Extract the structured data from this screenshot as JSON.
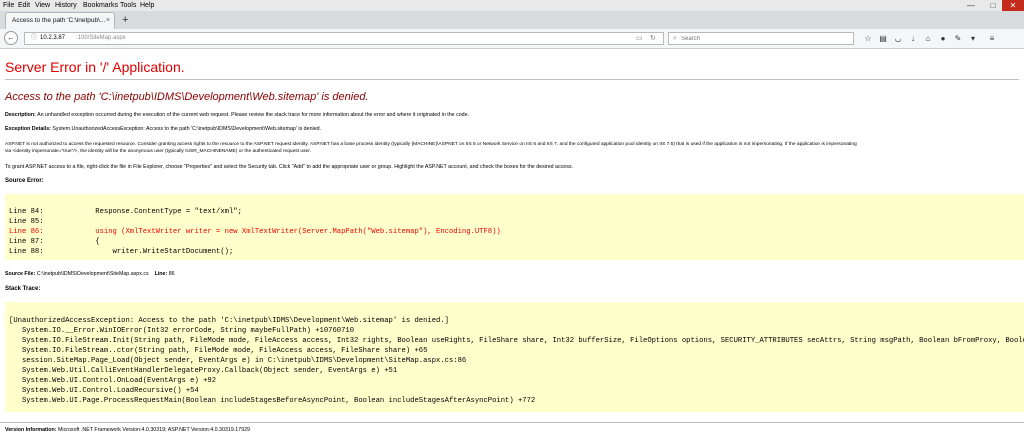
{
  "menu": {
    "items": [
      "File",
      "Edit",
      "View",
      "History",
      "Bookmarks",
      "Tools",
      "Help"
    ]
  },
  "window_controls": {
    "minimize": "—",
    "maximize": "□",
    "close": "✕"
  },
  "tab": {
    "title": "Access to the path 'C:\\inetpub\\...",
    "close": "×"
  },
  "new_tab": "+",
  "nav": {
    "back": "←",
    "url_host": "10.2.3.87",
    "url_path": ":100/SiteMap.aspx",
    "search_placeholder": "Search"
  },
  "page": {
    "h1": "Server Error in '/' Application.",
    "h2": "Access to the path 'C:\\inetpub\\IDMS\\Development\\Web.sitemap' is denied.",
    "description_label": "Description:",
    "description_text": " An unhandled exception occurred during the execution of the current web request. Please review the stack trace for more information about the error and where it originated in the code.",
    "exception_label": "Exception Details:",
    "exception_text": " System.UnauthorizedAccessException: Access to the path 'C:\\inetpub\\IDMS\\Development\\Web.sitemap' is denied.",
    "aspnet_line1": "ASP.NET is not authorized to access the requested resource. Consider granting access rights to the resource to the ASP.NET request identity. ASP.NET has a base process identity (typically {MACHINE}\\ASPNET on IIS 5 or Network Service on IIS 6 and IIS 7, and the configured application pool identity on IIS 7.5) that is used if the application is not impersonating. If the application is impersonating",
    "aspnet_line2": "via <identity impersonate=\"true\"/>, the identity will be the anonymous user (typically IUSR_MACHINENAME) or the authenticated request user.",
    "grant_text": "To grant ASP.NET access to a file, right-click the file in File Explorer, choose \"Properties\" and select the Security tab. Click \"Add\" to add the appropriate user or group. Highlight the ASP.NET account, and check the boxes for the desired access.",
    "source_error_label": "Source Error:",
    "source_lines": [
      "Line 84:            Response.ContentType = \"text/xml\";",
      "Line 85:",
      "Line 86:            using (XmlTextWriter writer = new XmlTextWriter(Server.MapPath(\"Web.sitemap\"), Encoding.UTF8))",
      "Line 87:            {",
      "Line 88:                writer.WriteStartDocument();"
    ],
    "source_file_label": "Source File:",
    "source_file_value": " C:\\inetpub\\IDMS\\Development\\SiteMap.aspx.cs",
    "line_label": "Line:",
    "line_value": " 86",
    "stack_trace_label": "Stack Trace:",
    "stack_lines": [
      "[UnauthorizedAccessException: Access to the path 'C:\\inetpub\\IDMS\\Development\\Web.sitemap' is denied.]",
      "   System.IO.__Error.WinIOError(Int32 errorCode, String maybeFullPath) +10760710",
      "   System.IO.FileStream.Init(String path, FileMode mode, FileAccess access, Int32 rights, Boolean useRights, FileShare share, Int32 bufferSize, FileOptions options, SECURITY_ATTRIBUTES secAttrs, String msgPath, Boolean bFromProxy, Boolean",
      "   System.IO.FileStream..ctor(String path, FileMode mode, FileAccess access, FileShare share) +65",
      "   session.SiteMap.Page_Load(Object sender, EventArgs e) in C:\\inetpub\\IDMS\\Development\\SiteMap.aspx.cs:86",
      "   System.Web.Util.CalliEventHandlerDelegateProxy.Callback(Object sender, EventArgs e) +51",
      "   System.Web.UI.Control.OnLoad(EventArgs e) +92",
      "   System.Web.UI.Control.LoadRecursive() +54",
      "   System.Web.UI.Page.ProcessRequestMain(Boolean includeStagesBeforeAsyncPoint, Boolean includeStagesAfterAsyncPoint) +772"
    ],
    "version_label": "Version Information:",
    "version_text": " Microsoft .NET Framework Version:4.0.30319; ASP.NET Version:4.0.30319.17929"
  },
  "colors": {
    "error_red": "#dd0000",
    "h2_red": "#8b0000",
    "code_bg": "#ffffcc",
    "highlight_line": "#ee0000"
  }
}
